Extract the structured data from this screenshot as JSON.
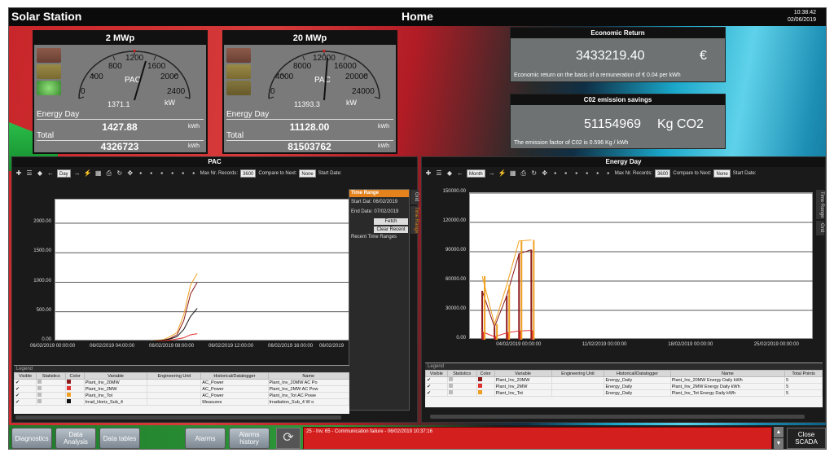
{
  "header": {
    "app_title": "Solar Station",
    "page_title": "Home",
    "time": "10:38:42",
    "date": "02/06/2019"
  },
  "gauges": [
    {
      "title": "2 MWp",
      "scale_labels": [
        "0",
        "400",
        "800",
        "1200",
        "1600",
        "2000",
        "2400"
      ],
      "label": "PAC",
      "reading": "1371.1",
      "unit": "kW",
      "energy_day_label": "Energy Day",
      "energy_day_value": "1427.88",
      "energy_day_unit": "kWh",
      "total_label": "Total",
      "total_value": "4326723",
      "total_unit": "kWh"
    },
    {
      "title": "20 MWp",
      "scale_labels": [
        "0",
        "4000",
        "8000",
        "12000",
        "16000",
        "20000",
        "24000"
      ],
      "label": "PAC",
      "reading": "11393.3",
      "unit": "kW",
      "energy_day_label": "Energy Day",
      "energy_day_value": "11128.00",
      "energy_day_unit": "kWh",
      "total_label": "Total",
      "total_value": "81503762",
      "total_unit": "kWh"
    }
  ],
  "economic": {
    "title": "Economic Return",
    "value": "3433219.40",
    "unit": "€",
    "note": "Economic return on the basis of a remuneration of € 0.04 per kWh"
  },
  "co2": {
    "title": "C02 emission savings",
    "value": "51154969",
    "unit": "Kg CO2",
    "note": "The emission factor of C02 is 0.596 Kg / kWh"
  },
  "pac_chart": {
    "title": "PAC",
    "period": "Day",
    "max_records_label": "Max Nr. Records:",
    "max_records": "3600",
    "compare_label": "Compare to Next:",
    "compare_value": "None",
    "start_date_label": "Start Date:",
    "side_tab": "Grid",
    "time_range": {
      "title": "Time Range",
      "start_label": "Start Dat:",
      "start_value": "06/02/2019",
      "end_label": "End Date:",
      "end_value": "07/02/2019",
      "fetch": "Fetch",
      "clear": "Clear Recent",
      "recent": "Recent Time Ranges",
      "vertical_tab": "Time Range"
    },
    "legend_title": "Legend",
    "legend_headers": [
      "Visible",
      "Statistics",
      "Color",
      "Variable",
      "Engineering Unit",
      "Historical/Datalogger",
      "Name"
    ],
    "legend_rows": [
      {
        "variable": "Plant_Inv_20MW",
        "eu": "",
        "hist": "AC_Power",
        "name": "Plant_Inv_20MW  AC Po",
        "color": "#8b1a1a"
      },
      {
        "variable": "Plant_Inv_2MW",
        "eu": "",
        "hist": "AC_Power",
        "name": "Plant_Inv_2MW  AC Pow",
        "color": "#e03030"
      },
      {
        "variable": "Plant_Inv_Tot",
        "eu": "",
        "hist": "AC_Power",
        "name": "Plant_Inv_Tot  AC Powe",
        "color": "#f0a020"
      },
      {
        "variable": "Irrad_Horiz_Sub_4",
        "eu": "",
        "hist": "Measures",
        "name": "Irradiation_Sub_4  W o",
        "color": "#111111"
      }
    ]
  },
  "energy_chart": {
    "title": "Energy Day",
    "period": "Month",
    "max_records_label": "Max Nr. Records:",
    "max_records": "3600",
    "compare_label": "Compare to Next:",
    "compare_value": "None",
    "start_date_label": "Start Date:",
    "side_tabs": [
      "Time Range",
      "Grid"
    ],
    "legend_title": "Legend",
    "legend_headers": [
      "Visible",
      "Statistics",
      "Color",
      "Variable",
      "Engineering Unit",
      "Historical/Datalogger",
      "Name",
      "Total Points"
    ],
    "legend_rows": [
      {
        "variable": "Plant_Inv_20MW",
        "eu": "",
        "hist": "Energy_Daily",
        "name": "Plant_Inv_20MW  Energy Daily  kWh",
        "points": "5",
        "color": "#8b1a1a"
      },
      {
        "variable": "Plant_Inv_2MW",
        "eu": "",
        "hist": "Energy_Daily",
        "name": "Plant_Inv_2MW  Energy Daily  kWh",
        "points": "5",
        "color": "#e03030"
      },
      {
        "variable": "Plant_Inv_Tot",
        "eu": "",
        "hist": "Energy_Daily",
        "name": "Plant_Inv_Tot  Energy Daily  kWh",
        "points": "5",
        "color": "#f0a020"
      }
    ]
  },
  "chart_data": [
    {
      "type": "line",
      "title": "PAC",
      "xlabel": "",
      "ylabel": "",
      "x_ticks": [
        "06/02/2019 00:00:00",
        "06/02/2019 04:00:00",
        "06/02/2019 08:00:00",
        "06/02/2019 12:00:00",
        "06/02/2019 16:00:00",
        "06/02/2019"
      ],
      "y_ticks": [
        "0.00",
        "500.00",
        "1000.00",
        "1500.00",
        "2000.00"
      ],
      "xlim": [
        0,
        22
      ],
      "ylim": [
        0,
        2400
      ],
      "grid": true,
      "series": [
        {
          "name": "Plant_Inv_20MW",
          "color": "#8b1a1a",
          "x": [
            7,
            8,
            8.5,
            9,
            9.5,
            10,
            10.5
          ],
          "y": [
            0,
            20,
            50,
            110,
            350,
            800,
            1000
          ]
        },
        {
          "name": "Plant_Inv_2MW",
          "color": "#e03030",
          "x": [
            7,
            8,
            8.5,
            9,
            9.5,
            10,
            10.5
          ],
          "y": [
            0,
            10,
            20,
            40,
            60,
            110,
            130
          ]
        },
        {
          "name": "Plant_Inv_Tot",
          "color": "#f0a020",
          "x": [
            7,
            8,
            8.5,
            9,
            9.5,
            10,
            10.5
          ],
          "y": [
            0,
            30,
            80,
            150,
            450,
            950,
            1150
          ]
        },
        {
          "name": "Irrad_Horiz_Sub_4",
          "color": "#111111",
          "x": [
            7,
            8,
            8.5,
            9,
            9.5,
            10,
            10.5
          ],
          "y": [
            0,
            20,
            40,
            80,
            200,
            420,
            560
          ]
        }
      ]
    },
    {
      "type": "line",
      "title": "Energy Day",
      "xlabel": "",
      "ylabel": "",
      "x_ticks": [
        "04/02/2019 00:00:00",
        "11/02/2019 00:00:00",
        "18/02/2019 00:00:00",
        "25/02/2019 00:00:00"
      ],
      "y_ticks": [
        "0.00",
        "30000.00",
        "60000.00",
        "90000.00",
        "120000.00",
        "150000.00"
      ],
      "xlim": [
        0,
        28
      ],
      "ylim": [
        0,
        150000
      ],
      "grid": true,
      "series": [
        {
          "name": "Plant_Inv_20MW",
          "color": "#8b1a1a",
          "x": [
            1,
            2,
            3,
            4,
            5
          ],
          "y": [
            50000,
            13000,
            45000,
            88000,
            92000
          ]
        },
        {
          "name": "Plant_Inv_2MW",
          "color": "#e03030",
          "x": [
            1,
            2,
            3,
            4,
            5
          ],
          "y": [
            8000,
            3000,
            7000,
            9000,
            9500
          ]
        },
        {
          "name": "Plant_Inv_Tot",
          "color": "#f0a020",
          "x": [
            1,
            2,
            3,
            4,
            5
          ],
          "y": [
            65000,
            16000,
            56000,
            101000,
            102000
          ]
        }
      ]
    }
  ],
  "bottom": {
    "buttons": [
      "Diagnostics",
      "Data Analysis",
      "Data tables",
      "Alarms",
      "Alarms history"
    ],
    "alarm_message": "25 - Inv. 65 - Communication failure - 06/02/2019 10:37:16",
    "close_label": "Close SCADA"
  }
}
